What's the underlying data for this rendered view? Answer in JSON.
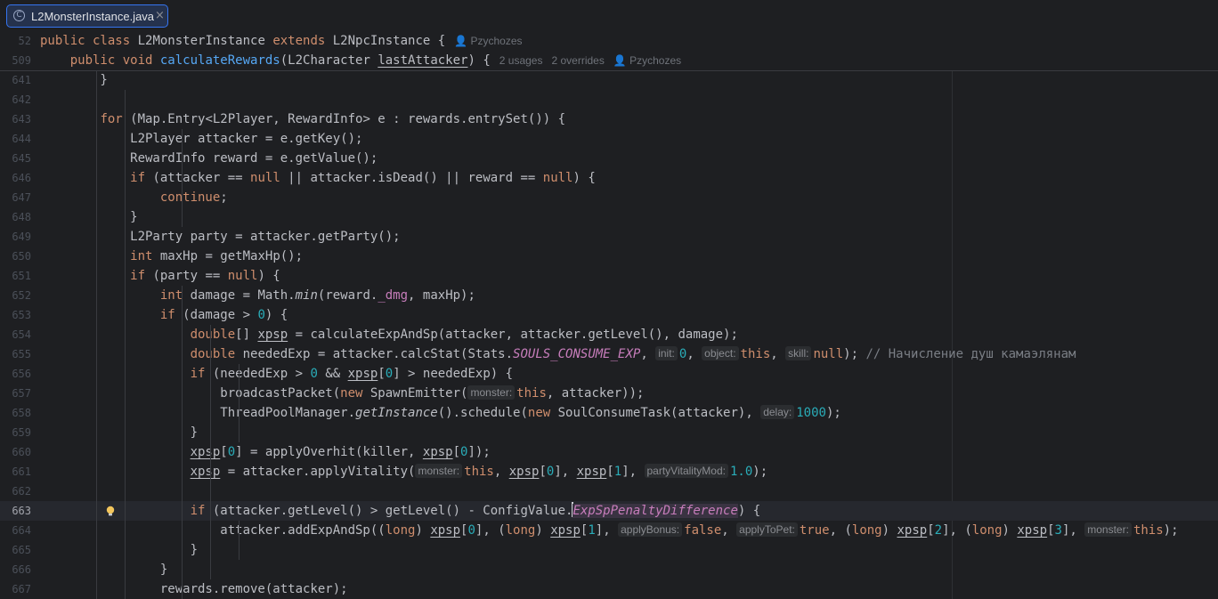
{
  "tab": {
    "label": "L2MonsterInstance.java",
    "icon": "java-class-icon",
    "close": "×"
  },
  "sticky": [
    {
      "ln": "52",
      "html": "<span class=\"k\">public class</span> L2MonsterInstance <span class=\"k\">extends</span> L2NpcInstance {<span class=\"meta\">👤 Pzychozes</span>"
    },
    {
      "ln": "509",
      "html": "    <span class=\"k\">public void</span> <span class=\"f\">calculateRewards</span>(L2Character <span class=\"u\">lastAttacker</span>) {<span class=\"meta\">2 usages</span><span class=\"meta\">2 overrides</span><span class=\"meta\">👤 Pzychozes</span>"
    }
  ],
  "lines": [
    {
      "ln": "641",
      "html": "        }"
    },
    {
      "ln": "642",
      "html": ""
    },
    {
      "ln": "643",
      "html": "        <span class=\"k\">for</span> (Map.Entry&lt;L2Player, RewardInfo&gt; e : rewards.entrySet()) {"
    },
    {
      "ln": "644",
      "html": "            L2Player attacker = e.getKey();"
    },
    {
      "ln": "645",
      "html": "            RewardInfo reward = e.getValue();"
    },
    {
      "ln": "646",
      "html": "            <span class=\"k\">if</span> (attacker == <span class=\"k\">null</span> || attacker.isDead() || reward == <span class=\"k\">null</span>) {"
    },
    {
      "ln": "647",
      "html": "                <span class=\"k\">continue</span>;"
    },
    {
      "ln": "648",
      "html": "            }"
    },
    {
      "ln": "649",
      "html": "            L2Party party = attacker.getParty();"
    },
    {
      "ln": "650",
      "html": "            <span class=\"k\">int</span> maxHp = getMaxHp();"
    },
    {
      "ln": "651",
      "html": "            <span class=\"k\">if</span> (party == <span class=\"k\">null</span>) {"
    },
    {
      "ln": "652",
      "html": "                <span class=\"k\">int</span> damage = Math.<span class=\"m\">min</span>(reward.<span class=\"s\" style=\"font-style:normal\">_dmg</span>, maxHp);"
    },
    {
      "ln": "653",
      "html": "                <span class=\"k\">if</span> (damage &gt; <span class=\"n\">0</span>) {"
    },
    {
      "ln": "654",
      "html": "                    <span class=\"k\">double</span>[] <span class=\"u\">xpsp</span> = calculateExpAndSp(attacker, attacker.getLevel(), damage);"
    },
    {
      "ln": "655",
      "html": "                    <span class=\"k\">double</span> neededExp = attacker.calcStat(Stats.<span class=\"s\">SOULS_CONSUME_EXP</span>, <span class=\"hint\">init:</span><span class=\"n\">0</span>, <span class=\"hint\">object:</span><span class=\"k\">this</span>, <span class=\"hint\">skill:</span><span class=\"k\">null</span>); <span class=\"c\">// Начисление душ камаэлянам</span>"
    },
    {
      "ln": "656",
      "html": "                    <span class=\"k\">if</span> (neededExp &gt; <span class=\"n\">0</span> &amp;&amp; <span class=\"u\">xpsp</span>[<span class=\"n\">0</span>] &gt; neededExp) {"
    },
    {
      "ln": "657",
      "html": "                        broadcastPacket(<span class=\"k\">new</span> SpawnEmitter(<span class=\"hint\">monster:</span><span class=\"k\">this</span>, attacker));"
    },
    {
      "ln": "658",
      "html": "                        ThreadPoolManager.<span class=\"m\">getInstance</span>().schedule(<span class=\"k\">new</span> SoulConsumeTask(attacker), <span class=\"hint\">delay:</span><span class=\"n\">1000</span>);"
    },
    {
      "ln": "659",
      "html": "                    }"
    },
    {
      "ln": "660",
      "html": "                    <span class=\"u\">xpsp</span>[<span class=\"n\">0</span>] = applyOverhit(killer, <span class=\"u\">xpsp</span>[<span class=\"n\">0</span>]);"
    },
    {
      "ln": "661",
      "html": "                    <span class=\"u\">xpsp</span> = attacker.applyVitality(<span class=\"hint\">monster:</span><span class=\"k\">this</span>, <span class=\"u\">xpsp</span>[<span class=\"n\">0</span>], <span class=\"u\">xpsp</span>[<span class=\"n\">1</span>], <span class=\"hint\">partyVitalityMod:</span><span class=\"n\">1.0</span>);"
    },
    {
      "ln": "662",
      "html": ""
    },
    {
      "ln": "663",
      "html": "                    <span class=\"k\">if</span> (attacker.getLevel() &gt; getLevel() - ConfigValue.<span class=\"caret\"></span><span class=\"s hl\">ExpSpPenaltyDifference</span>) {",
      "current": true
    },
    {
      "ln": "664",
      "html": "                        attacker.addExpAndSp((<span class=\"k\">long</span>) <span class=\"u\">xpsp</span>[<span class=\"n\">0</span>], (<span class=\"k\">long</span>) <span class=\"u\">xpsp</span>[<span class=\"n\">1</span>], <span class=\"hint\">applyBonus:</span><span class=\"k\">false</span>, <span class=\"hint\">applyToPet:</span><span class=\"k\">true</span>, (<span class=\"k\">long</span>) <span class=\"u\">xpsp</span>[<span class=\"n\">2</span>], (<span class=\"k\">long</span>) <span class=\"u\">xpsp</span>[<span class=\"n\">3</span>], <span class=\"hint\">monster:</span><span class=\"k\">this</span>);"
    },
    {
      "ln": "665",
      "html": "                    }"
    },
    {
      "ln": "666",
      "html": "                }"
    },
    {
      "ln": "667",
      "html": "                rewards.remove(attacker);"
    }
  ]
}
